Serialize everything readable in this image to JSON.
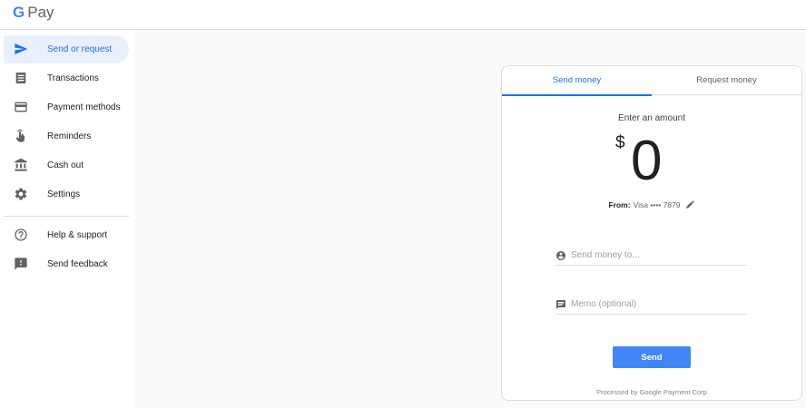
{
  "app": {
    "logo_g": "G",
    "logo_pay": "Pay"
  },
  "sidebar": {
    "items": [
      {
        "label": "Send or request",
        "icon": "send-icon"
      },
      {
        "label": "Transactions",
        "icon": "receipt-icon"
      },
      {
        "label": "Payment methods",
        "icon": "credit-card-icon"
      },
      {
        "label": "Reminders",
        "icon": "touch-hand-icon"
      },
      {
        "label": "Cash out",
        "icon": "bank-icon"
      },
      {
        "label": "Settings",
        "icon": "gear-icon"
      },
      {
        "label": "Help & support",
        "icon": "help-circle-icon"
      },
      {
        "label": "Send feedback",
        "icon": "feedback-icon"
      }
    ]
  },
  "card": {
    "tabs": [
      {
        "label": "Send money",
        "active": true
      },
      {
        "label": "Request money",
        "active": false
      }
    ],
    "amount_label": "Enter an amount",
    "currency_symbol": "$",
    "amount_value": "0",
    "from_label": "From:",
    "from_method": "Visa •••• 7879",
    "recipient": {
      "value": "",
      "placeholder": "Send money to..."
    },
    "memo": {
      "value": "",
      "placeholder": "Memo (optional)"
    },
    "send_label": "Send",
    "footer": "Processed by Google Payment Corp"
  },
  "colors": {
    "accent": "#1a73e8",
    "button": "#4285f4",
    "active_bg": "#e8f0fe"
  }
}
